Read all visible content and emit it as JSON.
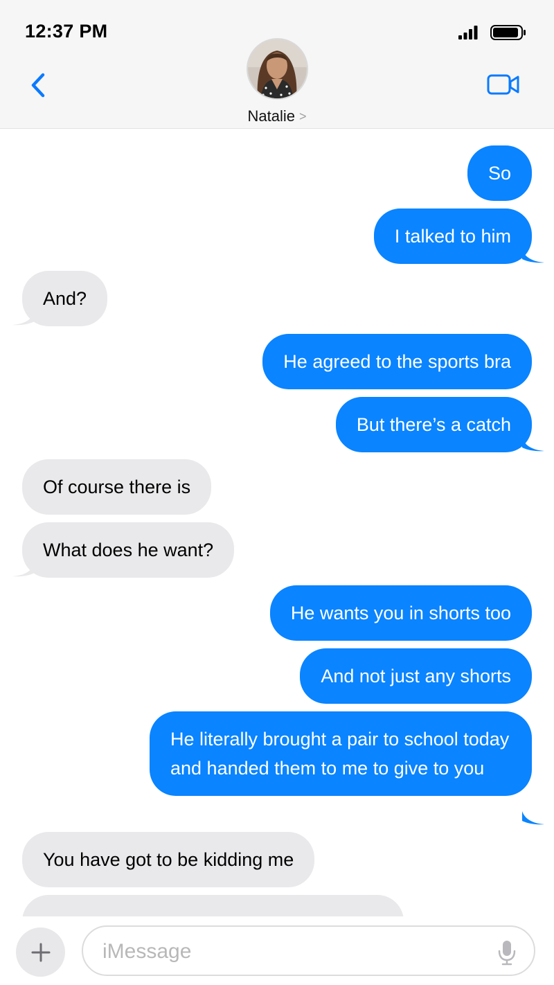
{
  "status_bar": {
    "time": "12:37 PM"
  },
  "header": {
    "contact_name": "Natalie",
    "contact_chevron": ">"
  },
  "messages": [
    {
      "direction": "out",
      "text": "So"
    },
    {
      "direction": "out",
      "text": "I talked to him"
    },
    {
      "direction": "in",
      "text": "And?"
    },
    {
      "direction": "out",
      "text": "He agreed to the sports bra"
    },
    {
      "direction": "out",
      "text": "But there’s a catch"
    },
    {
      "direction": "in",
      "text": "Of course there is"
    },
    {
      "direction": "in",
      "text": "What does he want?"
    },
    {
      "direction": "out",
      "text": "He wants you in shorts too"
    },
    {
      "direction": "out",
      "text": "And not just any shorts"
    },
    {
      "direction": "out",
      "text": "He literally brought a pair to school today and handed them to me to give to you"
    },
    {
      "direction": "in",
      "text": "You have got to be kidding me"
    },
    {
      "direction": "in",
      "text": ""
    }
  ],
  "composer": {
    "placeholder": "iMessage"
  },
  "colors": {
    "outgoing_bubble": "#0a84ff",
    "incoming_bubble": "#e9e9eb",
    "accent": "#0a7aff"
  },
  "icons": {
    "back": "chevron-left-icon",
    "video": "video-camera-icon",
    "plus": "plus-icon",
    "mic": "microphone-icon",
    "signal": "cell-signal-icon",
    "battery": "battery-icon"
  }
}
